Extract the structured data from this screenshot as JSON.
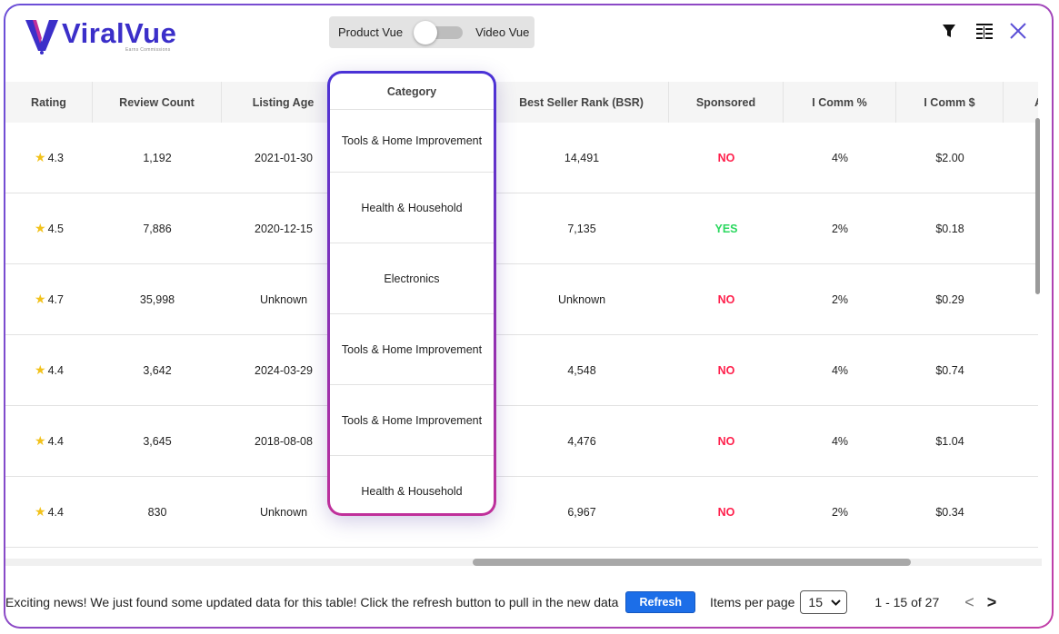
{
  "brand": {
    "name": "ViralVue",
    "tagline": "Earns Commissions"
  },
  "toggle": {
    "left_label": "Product Vue",
    "right_label": "Video Vue"
  },
  "table": {
    "columns": [
      "Rating",
      "Review Count",
      "Listing Age",
      "Category",
      "Best Seller Rank (BSR)",
      "Sponsored",
      "I Comm %",
      "I Comm $",
      "A"
    ],
    "rows": [
      {
        "rating": "4.3",
        "reviews": "1,192",
        "age": "2021-01-30",
        "category": "Tools & Home Improvement",
        "bsr": "14,491",
        "sponsored": "NO",
        "comm_pct": "4%",
        "comm_usd": "$2.00"
      },
      {
        "rating": "4.5",
        "reviews": "7,886",
        "age": "2020-12-15",
        "category": "Health & Household",
        "bsr": "7,135",
        "sponsored": "YES",
        "comm_pct": "2%",
        "comm_usd": "$0.18"
      },
      {
        "rating": "4.7",
        "reviews": "35,998",
        "age": "Unknown",
        "category": "Electronics",
        "bsr": "Unknown",
        "sponsored": "NO",
        "comm_pct": "2%",
        "comm_usd": "$0.29"
      },
      {
        "rating": "4.4",
        "reviews": "3,642",
        "age": "2024-03-29",
        "category": "Tools & Home Improvement",
        "bsr": "4,548",
        "sponsored": "NO",
        "comm_pct": "4%",
        "comm_usd": "$0.74"
      },
      {
        "rating": "4.4",
        "reviews": "3,645",
        "age": "2018-08-08",
        "category": "Tools & Home Improvement",
        "bsr": "4,476",
        "sponsored": "NO",
        "comm_pct": "4%",
        "comm_usd": "$1.04"
      },
      {
        "rating": "4.4",
        "reviews": "830",
        "age": "Unknown",
        "category": "Health & Household",
        "bsr": "6,967",
        "sponsored": "NO",
        "comm_pct": "2%",
        "comm_usd": "$0.34"
      }
    ]
  },
  "footer": {
    "notice": "Exciting news! We just found some updated data for this table! Click the refresh button to pull in the new data",
    "refresh_label": "Refresh",
    "items_per_page_label": "Items per page",
    "items_per_page_value": "15",
    "range_text": "1 - 15 of 27"
  },
  "icons": {
    "star": "star-icon",
    "filter": "filter-icon",
    "columns": "columns-icon",
    "close": "close-icon",
    "prev": "chevron-left-icon",
    "next": "chevron-right-icon"
  },
  "colors": {
    "brand": "#3b2fc9",
    "accent_gradient_start": "#4a32d6",
    "accent_gradient_end": "#c0309a",
    "no": "#ff1f4b",
    "yes": "#2bd85f",
    "star": "#f2c21b",
    "refresh": "#1c6ee8"
  }
}
